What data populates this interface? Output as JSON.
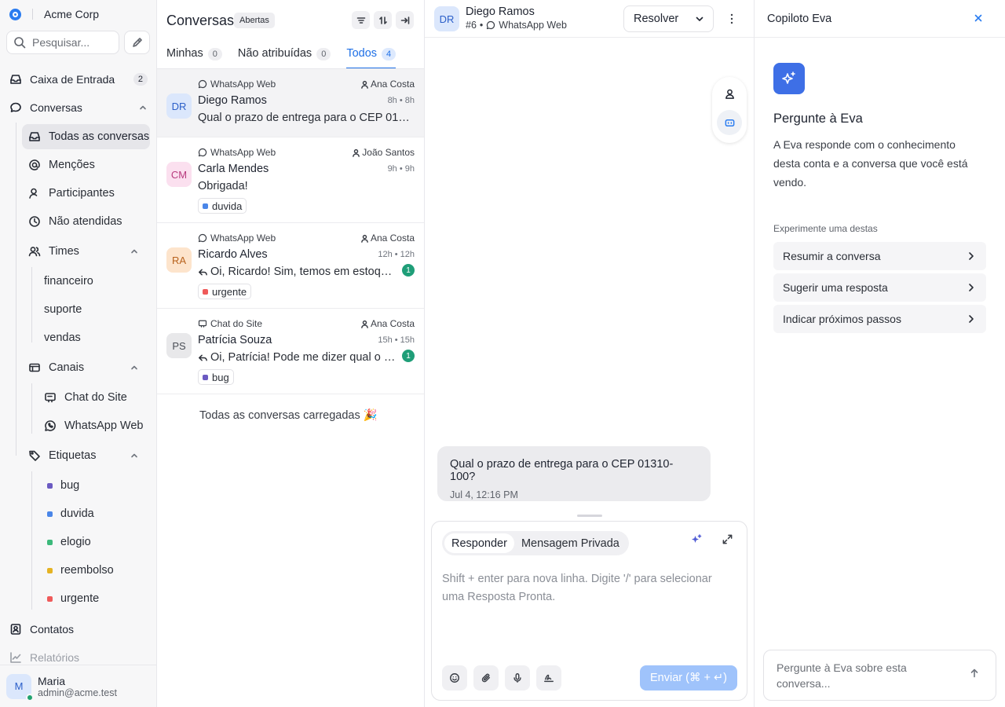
{
  "sidebar": {
    "brand": "Acme Corp",
    "search_placeholder": "Pesquisar...",
    "inbox": {
      "label": "Caixa de Entrada",
      "count": "2"
    },
    "conversations_label": "Conversas",
    "sub": {
      "all": "Todas as conversas",
      "mentions": "Menções",
      "participants": "Participantes",
      "unattended": "Não atendidas",
      "teams": "Times",
      "channels": "Canais",
      "labels": "Etiquetas"
    },
    "teams": [
      "financeiro",
      "suporte",
      "vendas"
    ],
    "channels": [
      "Chat do Site",
      "WhatsApp Web"
    ],
    "labels": [
      {
        "name": "bug",
        "color": "#6b5ac2"
      },
      {
        "name": "duvida",
        "color": "#4a86e8"
      },
      {
        "name": "elogio",
        "color": "#3cb97b"
      },
      {
        "name": "reembolso",
        "color": "#e5b323"
      },
      {
        "name": "urgente",
        "color": "#ef5a5a"
      }
    ],
    "contacts": "Contatos",
    "reports": "Relatórios",
    "user": {
      "initial": "M",
      "name": "Maria",
      "email": "admin@acme.test"
    }
  },
  "list": {
    "title": "Conversas",
    "status": "Abertas",
    "tabs": [
      {
        "label": "Minhas",
        "count": "0"
      },
      {
        "label": "Não atribuídas",
        "count": "0"
      },
      {
        "label": "Todos",
        "count": "4"
      }
    ],
    "conversations": [
      {
        "initials": "DR",
        "channel": "WhatsApp Web",
        "assignee": "Ana Costa",
        "name": "Diego Ramos",
        "time": "8h • 8h",
        "message": "Qual o prazo de entrega para o CEP 01310-100?",
        "avatar_bg": "#dbe7fc",
        "avatar_fg": "#2b5fc9"
      },
      {
        "initials": "CM",
        "channel": "WhatsApp Web",
        "assignee": "João Santos",
        "name": "Carla Mendes",
        "time": "9h • 9h",
        "message": "Obrigada!",
        "tag": "duvida",
        "tag_color": "#4a86e8",
        "avatar_bg": "#fbe0ef",
        "avatar_fg": "#b83b7e"
      },
      {
        "initials": "RA",
        "channel": "WhatsApp Web",
        "assignee": "Ana Costa",
        "name": "Ricardo Alves",
        "time": "12h • 12h",
        "message": "Oi, Ricardo! Sim, temos em estoque.",
        "unread": "1",
        "tag": "urgente",
        "tag_color": "#ef5a5a",
        "avatar_bg": "#fde4cc",
        "avatar_fg": "#b8621d"
      },
      {
        "initials": "PS",
        "channel": "Chat do Site",
        "assignee": "Ana Costa",
        "name": "Patrícia Souza",
        "time": "15h • 15h",
        "message": "Oi, Patrícia! Pode me dizer qual o erro?",
        "unread": "1",
        "tag": "bug",
        "tag_color": "#6b5ac2",
        "avatar_bg": "#e8e8ea",
        "avatar_fg": "#4a4e56"
      }
    ],
    "all_loaded": "Todas as conversas carregadas 🎉"
  },
  "chat": {
    "initials": "DR",
    "name": "Diego Ramos",
    "id": "#6",
    "channel": "WhatsApp Web",
    "resolve": "Resolver",
    "message": {
      "text": "Qual o prazo de entrega para o CEP 01310-100?",
      "date": "Jul 4, 12:16 PM"
    },
    "reply_tab": "Responder",
    "private_tab": "Mensagem Privada",
    "placeholder": "Shift + enter para nova linha. Digite '/' para selecionar uma Resposta Pronta.",
    "send": "Enviar (⌘ + ↵)"
  },
  "copilot": {
    "title": "Copiloto Eva",
    "heading": "Pergunte à Eva",
    "description": "A Eva responde com o conhecimento desta conta e a conversa que você está vendo.",
    "suggestions_title": "Experimente uma destas",
    "suggestions": [
      "Resumir a conversa",
      "Sugerir uma resposta",
      "Indicar próximos passos"
    ],
    "input_placeholder": "Pergunte à Eva sobre esta conversa..."
  }
}
